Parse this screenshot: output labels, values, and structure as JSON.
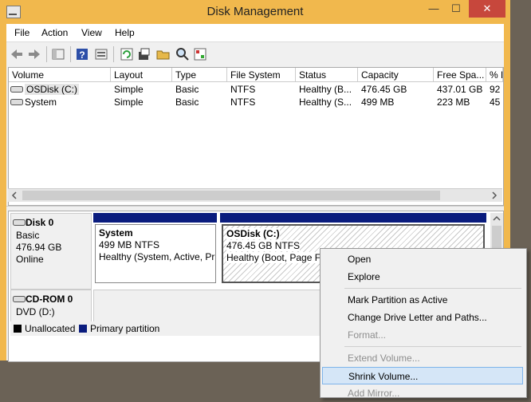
{
  "window": {
    "title": "Disk Management",
    "close": "✕",
    "minimize": "—",
    "maximize": "☐"
  },
  "menu": [
    "File",
    "Action",
    "View",
    "Help"
  ],
  "toolbar_icons": [
    "back-icon",
    "forward-icon",
    "up-icon",
    "help-icon",
    "properties-icon",
    "refresh-icon",
    "rescan-icon",
    "open-icon",
    "search-icon",
    "settings-icon"
  ],
  "columns": [
    "Volume",
    "Layout",
    "Type",
    "File System",
    "Status",
    "Capacity",
    "Free Spa...",
    "% F"
  ],
  "volumes": [
    [
      "OSDisk (C:)",
      "Simple",
      "Basic",
      "NTFS",
      "Healthy (B...",
      "476.45 GB",
      "437.01 GB",
      "92"
    ],
    [
      "System",
      "Simple",
      "Basic",
      "NTFS",
      "Healthy (S...",
      "499 MB",
      "223 MB",
      "45"
    ]
  ],
  "disks": {
    "disk0": {
      "name": "Disk 0",
      "type": "Basic",
      "size": "476.94 GB",
      "state": "Online"
    },
    "cdrom": {
      "name": "CD-ROM 0",
      "type": "DVD (D:)"
    }
  },
  "partitions": [
    {
      "name": "System",
      "size": "499 MB NTFS",
      "status": "Healthy (System, Active, Pr"
    },
    {
      "name": "OSDisk  (C:)",
      "size": "476.45 GB NTFS",
      "status": "Healthy (Boot, Page Fil"
    }
  ],
  "legend": [
    {
      "label": "Unallocated",
      "color": "#000000"
    },
    {
      "label": "Primary partition",
      "color": "#0a1c7e"
    }
  ],
  "context_menu": {
    "open": "Open",
    "explore": "Explore",
    "mark_active": "Mark Partition as Active",
    "change_letter": "Change Drive Letter and Paths...",
    "format": "Format...",
    "extend": "Extend Volume...",
    "shrink": "Shrink Volume...",
    "add_mirror": "Add Mirror..."
  }
}
